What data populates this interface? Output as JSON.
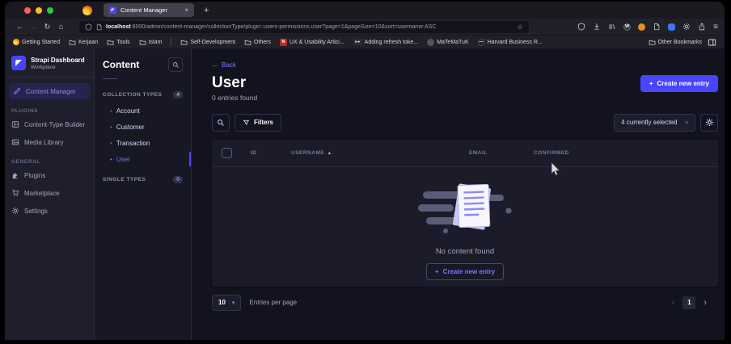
{
  "colors": {
    "accent": "#4945ff",
    "accent_text": "#7b79ff",
    "page_bg": "#131320",
    "card_bg": "#1b1b2a",
    "chrome_bg": "#202028"
  },
  "icons": {
    "back": "←",
    "forward": "→",
    "reload": "↻",
    "home": "⌂",
    "star": "☆",
    "hamburger": "≡",
    "close": "×",
    "plus": "+",
    "chevron_down": "▾",
    "sort_asc": "▴",
    "chevron_left": "‹",
    "chevron_right": "›",
    "bullet": "•",
    "w_badge": "W",
    "strapi_arrow": "↗",
    "dots_badge": "●●"
  },
  "browser": {
    "tab_title": "Content Manager",
    "url_host": "localhost",
    "url_rest": ":8000/admin/content-manager/collectionType/plugin::users-permissions.user?page=1&pageSize=10&sort=username:ASC",
    "bookmarks": [
      {
        "label": "Getting Started"
      },
      {
        "label": "Kerjaan"
      },
      {
        "label": "Tools"
      },
      {
        "label": "Islam"
      },
      {
        "label": "Self-Development"
      },
      {
        "label": "Others"
      },
      {
        "label": "UX & Usability Artici..."
      },
      {
        "label": "Adding refresh toke..."
      },
      {
        "label": "MaTeMaTuK"
      },
      {
        "label": "Harvard Business R..."
      }
    ],
    "other_bookmarks": "Other Bookmarks"
  },
  "sidebar": {
    "brand": {
      "title": "Strapi Dashboard",
      "subtitle": "Workplace"
    },
    "active_item": "Content Manager",
    "sections": [
      {
        "label": "PLUGINS",
        "items": [
          "Content-Type Builder",
          "Media Library"
        ]
      },
      {
        "label": "GENERAL",
        "items": [
          "Plugins",
          "Marketplace",
          "Settings"
        ]
      }
    ]
  },
  "subnav": {
    "title": "Content",
    "collection": {
      "label": "COLLECTION TYPES",
      "badge": "4",
      "items": [
        "Account",
        "Customer",
        "Transaction",
        "User"
      ],
      "active_item": "User"
    },
    "single": {
      "label": "SINGLE TYPES",
      "badge": "0"
    }
  },
  "main": {
    "back_label": "Back",
    "title": "User",
    "subtitle": "0 entries found",
    "create_button": "Create new entry",
    "filters_button": "Filters",
    "selected_dropdown": "4 currently selected",
    "table": {
      "columns": [
        "ID",
        "USERNAME",
        "EMAIL",
        "CONFIRMED"
      ]
    },
    "empty": {
      "message": "No content found",
      "button": "Create new entry"
    },
    "pagination": {
      "page_size": "10",
      "label": "Entries per page",
      "current_page": "1"
    }
  }
}
